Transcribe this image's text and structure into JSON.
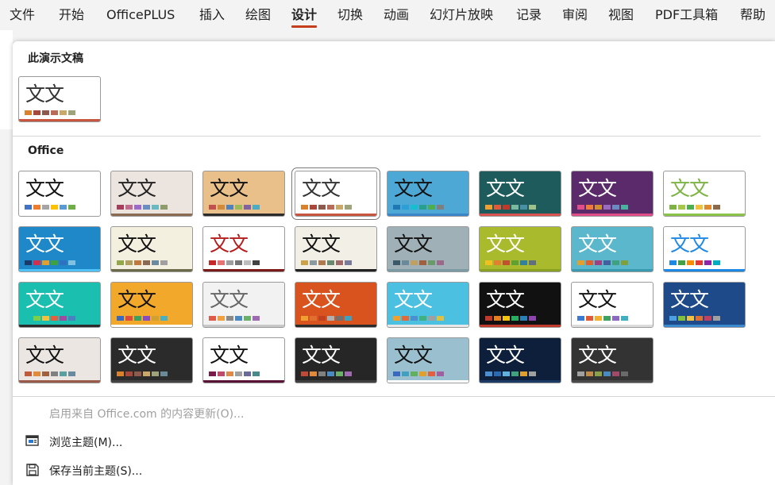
{
  "ribbon": {
    "tabs": [
      {
        "label": "文件",
        "active": false
      },
      {
        "label": "开始",
        "active": false
      },
      {
        "label": "OfficePLUS",
        "active": false
      },
      {
        "label": "插入",
        "active": false
      },
      {
        "label": "绘图",
        "active": false
      },
      {
        "label": "设计",
        "active": true
      },
      {
        "label": "切换",
        "active": false
      },
      {
        "label": "动画",
        "active": false
      },
      {
        "label": "幻灯片放映",
        "active": false
      },
      {
        "label": "记录",
        "active": false
      },
      {
        "label": "审阅",
        "active": false
      },
      {
        "label": "视图",
        "active": false
      },
      {
        "label": "PDF工具箱",
        "active": false
      },
      {
        "label": "帮助",
        "active": false
      }
    ]
  },
  "gallery": {
    "this_presentation": {
      "header": "此演示文稿",
      "theme": {
        "text": "文文",
        "bg": "#ffffff",
        "fg": "#333333",
        "swatches": [
          "#d9822b",
          "#a8483a",
          "#8e5a4e",
          "#b86c57",
          "#c9a86a",
          "#9ea37b"
        ],
        "accent": "#c8553d"
      }
    },
    "office": {
      "header": "Office",
      "themes": [
        {
          "text": "文文",
          "bg": "#ffffff",
          "fg": "#111111",
          "swatches": [
            "#4472c4",
            "#ed7d31",
            "#a5a5a5",
            "#ffc000",
            "#5b9bd5",
            "#70ad47"
          ],
          "selected": false
        },
        {
          "text": "文文",
          "bg": "#ece4df",
          "fg": "#222222",
          "swatches": [
            "#a53e5a",
            "#c06b8e",
            "#9c6bc9",
            "#6b8ec0",
            "#6bb9c0",
            "#8e9c6b"
          ],
          "accent": "#8a6b52",
          "selected": false
        },
        {
          "text": "文文",
          "bg": "#e9c08a",
          "fg": "#111111",
          "swatches": [
            "#c0504d",
            "#d08a3a",
            "#4f81bd",
            "#9bbb59",
            "#8064a2",
            "#4bacc6"
          ],
          "accent": "#2b2b2b",
          "selected": false
        },
        {
          "text": "文文",
          "bg": "#ffffff",
          "fg": "#333333",
          "swatches": [
            "#d9822b",
            "#a8483a",
            "#8e5a4e",
            "#b86c57",
            "#c9a86a",
            "#9ea37b"
          ],
          "accent": "#c8553d",
          "selected": true
        },
        {
          "text": "文文",
          "bg": "#4ea8d6",
          "fg": "#111111",
          "swatches": [
            "#1f77b4",
            "#2ca0d6",
            "#17becf",
            "#27a08e",
            "#4cae4c",
            "#7f7f7f"
          ],
          "accent": "#3a86c8",
          "selected": false
        },
        {
          "text": "文文",
          "bg": "#1e5b5c",
          "fg": "#ffffff",
          "swatches": [
            "#f0a030",
            "#e05a3a",
            "#c0392b",
            "#7ab8a0",
            "#4a90a4",
            "#9ec08a"
          ],
          "accent": "#d9534f",
          "selected": false
        },
        {
          "text": "文文",
          "bg": "#5a2a6a",
          "fg": "#ffffff",
          "swatches": [
            "#e04e8a",
            "#f07a3a",
            "#d09030",
            "#9a6ac0",
            "#6a8ac0",
            "#4ab0a0"
          ],
          "accent": "#e04e8a",
          "selected": false
        },
        {
          "text": "文文",
          "bg": "#ffffff",
          "fg": "#7cb342",
          "swatches": [
            "#7cb342",
            "#a5c84a",
            "#4caf50",
            "#f0c040",
            "#e08a30",
            "#8a6a4a"
          ],
          "accent": "#8bc34a",
          "selected": false
        },
        {
          "text": "文文",
          "bg": "#1e88c8",
          "fg": "#ffffff",
          "swatches": [
            "#1a3a6a",
            "#d03050",
            "#e0a030",
            "#40a040",
            "#3070c0",
            "#80c0e0"
          ],
          "accent": "#4fc3f7",
          "selected": false
        },
        {
          "text": "文文",
          "bg": "#f4f0e0",
          "fg": "#111111",
          "swatches": [
            "#93a84a",
            "#b0a060",
            "#c07a40",
            "#8a6a50",
            "#6a8aa0",
            "#a0a0a0"
          ],
          "accent": "#6b6b4a",
          "selected": false
        },
        {
          "text": "文文",
          "bg": "#ffffff",
          "fg": "#b71c1c",
          "swatches": [
            "#c62828",
            "#e57373",
            "#9e9e9e",
            "#757575",
            "#bdbdbd",
            "#424242"
          ],
          "accent": "#7a1a1a",
          "selected": false
        },
        {
          "text": "文文",
          "bg": "#f2efe6",
          "fg": "#111111",
          "swatches": [
            "#c9a24a",
            "#8a9aa0",
            "#b07a50",
            "#6a8a70",
            "#a06a6a",
            "#7a7a9a"
          ],
          "accent": "#222222",
          "selected": false
        },
        {
          "text": "文文",
          "bg": "#9fb1b7",
          "fg": "#111111",
          "swatches": [
            "#3a5a6a",
            "#6a8a9a",
            "#c0a060",
            "#a06040",
            "#6a9a6a",
            "#9a6a8a"
          ],
          "accent": "#7a9aa4",
          "selected": false
        },
        {
          "text": "文文",
          "bg": "#a9bb2c",
          "fg": "#ffffff",
          "swatches": [
            "#f0c020",
            "#e08030",
            "#c05030",
            "#60a030",
            "#3080a0",
            "#607080"
          ],
          "accent": "#8aa022",
          "selected": false
        },
        {
          "text": "文文",
          "bg": "#5bb8cc",
          "fg": "#ffffff",
          "swatches": [
            "#e0a030",
            "#e06030",
            "#a04080",
            "#4060a0",
            "#40a080",
            "#80a040"
          ],
          "accent": "#3a9ab0",
          "selected": false
        },
        {
          "text": "文文",
          "bg": "#ffffff",
          "fg": "#1e88e5",
          "swatches": [
            "#1e88e5",
            "#43a047",
            "#fb8c00",
            "#e53935",
            "#8e24aa",
            "#00acc1"
          ],
          "accent": "#1e88e5",
          "selected": false
        },
        {
          "text": "文文",
          "bg": "#1bbfb0",
          "fg": "#ffffff",
          "swatches": [
            "#1bbfb0",
            "#7ad04a",
            "#f0c040",
            "#e06040",
            "#a04aa0",
            "#4a80c0"
          ],
          "accent": "#2b2b2b",
          "selected": false
        },
        {
          "text": "文文",
          "bg": "#f2a82a",
          "fg": "#111111",
          "swatches": [
            "#3a6ac0",
            "#e04a3a",
            "#40a060",
            "#8a4ac0",
            "#d0a030",
            "#4ab0c0"
          ],
          "accent": "#ffffff",
          "selected": false
        },
        {
          "text": "文文",
          "bg": "#f2f2f2",
          "fg": "#666666",
          "swatches": [
            "#e05a4a",
            "#f0a040",
            "#8a8a8a",
            "#4a8ac0",
            "#6ab06a",
            "#a06ab0"
          ],
          "accent": "#c8c8c8",
          "selected": false
        },
        {
          "text": "文文",
          "bg": "#d9531e",
          "fg": "#ffffff",
          "swatches": [
            "#f0a030",
            "#e07030",
            "#c04020",
            "#b0b0b0",
            "#707070",
            "#40a0c0"
          ],
          "accent": "#2b2b2b",
          "selected": false
        },
        {
          "text": "文文",
          "bg": "#4cc0e0",
          "fg": "#ffffff",
          "swatches": [
            "#f0a030",
            "#e06a3a",
            "#4a90d0",
            "#40b080",
            "#a0a0a0",
            "#e0c040"
          ],
          "accent": "#e8e8e8",
          "selected": false
        },
        {
          "text": "文文",
          "bg": "#111111",
          "fg": "#ffffff",
          "swatches": [
            "#c0392b",
            "#e67e22",
            "#f1c40f",
            "#27ae60",
            "#2980b9",
            "#8e44ad"
          ],
          "accent": "#c0392b",
          "selected": false
        },
        {
          "text": "文文",
          "bg": "#ffffff",
          "fg": "#111111",
          "swatches": [
            "#3a7ad0",
            "#e05a3a",
            "#f0b030",
            "#40a060",
            "#8a6ac0",
            "#40b0c0"
          ],
          "accent": "#dcdcdc",
          "selected": false
        },
        {
          "text": "文文",
          "bg": "#1e4a8a",
          "fg": "#ffffff",
          "swatches": [
            "#4aa0e0",
            "#80c040",
            "#f0c040",
            "#e07030",
            "#c04060",
            "#a0a0a0"
          ],
          "accent": "#3a8ad0",
          "selected": false
        },
        {
          "text": "文文",
          "bg": "#ebe6e1",
          "fg": "#111111",
          "swatches": [
            "#c05a3a",
            "#e08a3a",
            "#a06040",
            "#808080",
            "#5aa0a0",
            "#6a8aa0"
          ],
          "accent": "#9a5a4a",
          "selected": false
        },
        {
          "text": "文文",
          "bg": "#2b2b2b",
          "fg": "#ffffff",
          "swatches": [
            "#d9822b",
            "#a8483a",
            "#8e5a4e",
            "#c9a86a",
            "#9ea37b",
            "#6a8a9a"
          ],
          "accent": "#444444",
          "selected": false
        },
        {
          "text": "文文",
          "bg": "#ffffff",
          "fg": "#111111",
          "swatches": [
            "#7a1a4a",
            "#c04a6a",
            "#e08a4a",
            "#a0a0a0",
            "#6a6a9a",
            "#4a8a8a"
          ],
          "accent": "#5a1236",
          "selected": false
        },
        {
          "text": "文文",
          "bg": "#262626",
          "fg": "#ffffff",
          "swatches": [
            "#c04a3a",
            "#e08a3a",
            "#808080",
            "#4a8ac0",
            "#6ab06a",
            "#a06ab0"
          ],
          "accent": "#404040",
          "selected": false
        },
        {
          "text": "文文",
          "bg": "#9ac0d0",
          "fg": "#111111",
          "swatches": [
            "#3a6ac0",
            "#40a0c0",
            "#60b060",
            "#e0a030",
            "#e06040",
            "#a060a0"
          ],
          "accent": "#ffffff",
          "selected": false
        },
        {
          "text": "文文",
          "bg": "#0d1f3a",
          "fg": "#ffffff",
          "swatches": [
            "#4a90d0",
            "#2a6ab0",
            "#60b0e0",
            "#40a080",
            "#e0a030",
            "#a0a0a0"
          ],
          "accent": "#1c3a66",
          "selected": false
        },
        {
          "text": "文文",
          "bg": "#333333",
          "fg": "#ffffff",
          "swatches": [
            "#a0a0a0",
            "#c08a4a",
            "#8aa04a",
            "#4a8ac0",
            "#a04a6a",
            "#6a6a6a"
          ],
          "accent": "#4a4a4a",
          "selected": false
        }
      ]
    }
  },
  "menu": {
    "enable_updates": {
      "label": "启用来自 Office.com 的内容更新(O)...",
      "enabled": false
    },
    "browse": {
      "label": "浏览主题(M)...",
      "icon": "browse-themes-icon"
    },
    "save": {
      "label": "保存当前主题(S)...",
      "icon": "save-theme-icon"
    }
  }
}
